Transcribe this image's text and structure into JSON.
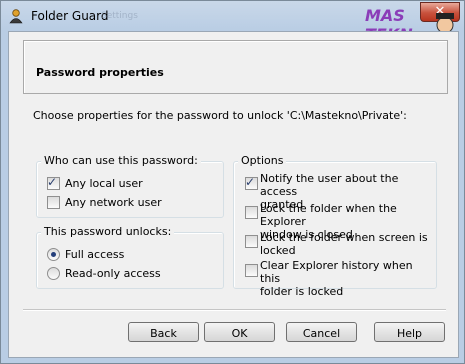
{
  "window": {
    "title": "Folder Guard",
    "ghost_text": "Settings"
  },
  "watermark": {
    "line1": "MAS",
    "line2": "TEKN"
  },
  "banner": {
    "title": "Password properties"
  },
  "instructions": "Choose properties for the password to unlock 'C:\\Mastekno\\Private':",
  "who_group": {
    "title": "Who can use this password:",
    "options": [
      {
        "label": "Any local user",
        "checked": true
      },
      {
        "label": "Any network user",
        "checked": false
      }
    ]
  },
  "unlock_group": {
    "title": "This password unlocks:",
    "options": [
      {
        "label": "Full access",
        "selected": true
      },
      {
        "label": "Read-only access",
        "selected": false
      }
    ]
  },
  "options_group": {
    "title": "Options",
    "options": [
      {
        "line1": "Notify the user about the access",
        "line2": "granted",
        "checked": true
      },
      {
        "line1": "Lock the folder when the Explorer",
        "line2": "window is closed",
        "checked": false
      },
      {
        "line1": "Lock the folder when screen is",
        "line2": "locked",
        "checked": false
      },
      {
        "line1": "Clear Explorer history when this",
        "line2": "folder is locked",
        "checked": false
      }
    ]
  },
  "buttons": {
    "back": "Back",
    "ok": "OK",
    "cancel": "Cancel",
    "help": "Help"
  },
  "colors": {
    "close": "#c8523d",
    "frame": "#b9cde4",
    "accent": "#2a3f6e",
    "watermark": "#8b3db8"
  },
  "icons": {
    "app": "user-lock-icon",
    "close": "close-icon"
  }
}
